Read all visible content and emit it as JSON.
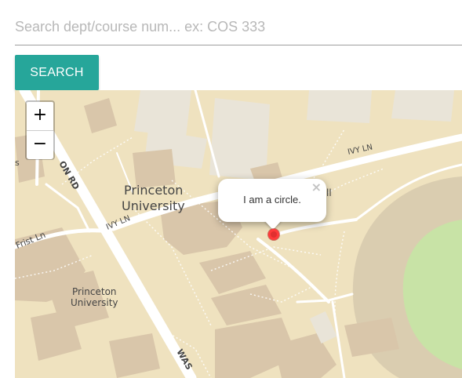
{
  "search": {
    "placeholder": "Search dept/course num... ex: COS 333",
    "value": "",
    "button_label": "SEARCH"
  },
  "map": {
    "zoom_in_label": "+",
    "zoom_out_label": "−",
    "popup": {
      "text": "I am a circle.",
      "close_label": "×"
    },
    "labels": {
      "campus_main_line1": "Princeton",
      "campus_main_line2": "University",
      "campus_small_line1": "Princeton",
      "campus_small_line2": "University",
      "ivy_ln_lower": "IVY LN",
      "ivy_ln_upper": "IVY LN",
      "frist_ln": "Frist Ln",
      "washington_rd_top": "ON RD",
      "washington_rd_bottom": "WAS",
      "road_fragment_left": "s",
      "popup_hidden_suffix": "ll"
    },
    "colors": {
      "land": "#efe2bf",
      "building": "#d9c6aa",
      "building_pale": "#e9e4d8",
      "road": "#ffffff",
      "park": "#c8e3a6",
      "track": "#dacdb0",
      "marker": "#e03030"
    }
  },
  "colors": {
    "accent": "#26a69a"
  }
}
